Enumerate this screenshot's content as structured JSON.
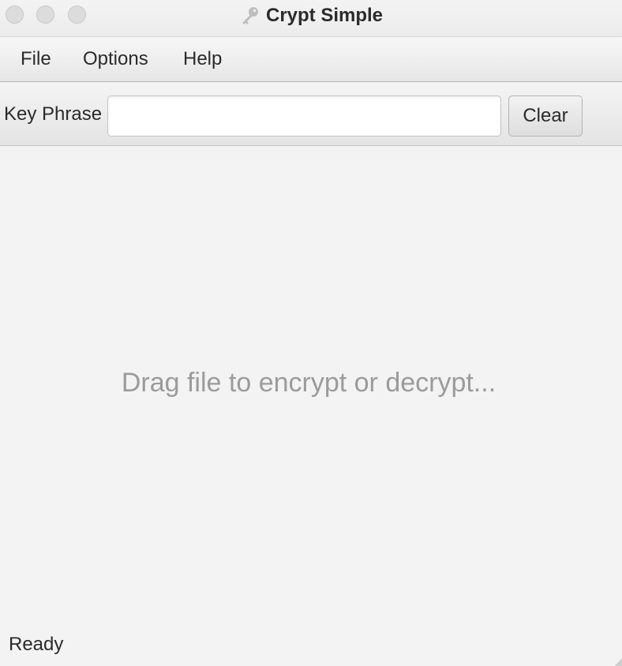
{
  "window": {
    "title": "Crypt Simple",
    "title_icon": "key-icon"
  },
  "menu": {
    "items": [
      {
        "label": "File"
      },
      {
        "label": "Options"
      },
      {
        "label": "Help"
      }
    ]
  },
  "toolbar": {
    "key_phrase_label": "Key Phrase",
    "key_phrase_value": "",
    "clear_label": "Clear"
  },
  "main": {
    "drop_hint": "Drag file to encrypt or decrypt..."
  },
  "status": {
    "text": "Ready"
  },
  "colors": {
    "background": "#f3f3f3",
    "hint_text": "#9b9b9b",
    "text": "#2a2a2a"
  }
}
